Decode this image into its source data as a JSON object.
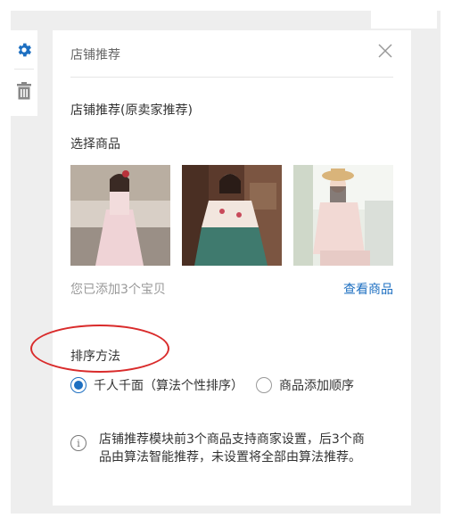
{
  "panel": {
    "title": "店铺推荐",
    "module_name": "店铺推荐(原卖家推荐)",
    "select_products_label": "选择商品",
    "added_text": "您已添加3个宝贝",
    "view_products_link": "查看商品",
    "sort_label": "排序方法",
    "sort_options": [
      {
        "label": "千人千面（算法个性排序）",
        "checked": true
      },
      {
        "label": "商品添加顺序",
        "checked": false
      }
    ],
    "info_line1": "店铺推荐模块前3个商品支持商家设置，后3个商",
    "info_line2": "品由算法智能推荐，未设置将全部由算法推荐。"
  },
  "toolbar": {
    "icons": [
      "gear-icon",
      "trash-icon"
    ]
  },
  "colors": {
    "accent": "#1d6fc1",
    "annotation": "#d92b2b",
    "background": "#eeeeee"
  }
}
